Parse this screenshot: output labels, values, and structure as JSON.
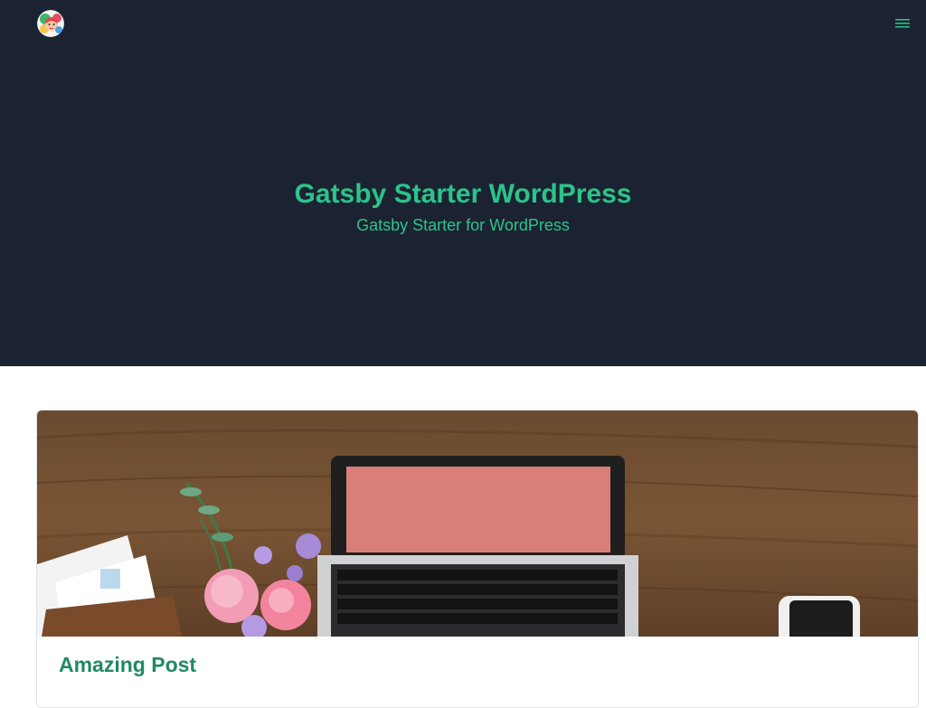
{
  "nav": {
    "logo_icon": "avatar-logo-icon",
    "menu_icon": "hamburger-menu-icon"
  },
  "hero": {
    "title": "Gatsby Starter WordPress",
    "subtitle": "Gatsby Starter for WordPress"
  },
  "posts": [
    {
      "title": "Amazing Post",
      "image": "laptop-desk-flowers-photo"
    }
  ],
  "colors": {
    "header_bg": "#1b2332",
    "accent": "#2bc48a",
    "post_title": "#1e8a61"
  }
}
